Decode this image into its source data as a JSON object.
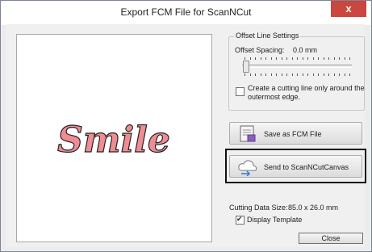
{
  "window": {
    "title": "Export FCM File for ScanNCut",
    "close_glyph": "x"
  },
  "preview": {
    "word": "Smile",
    "fill_color": "#f08c94",
    "stroke_color": "#222222"
  },
  "offset_group": {
    "legend": "Offset Line Settings",
    "spacing_label": "Offset Spacing:",
    "spacing_value": "0.0 mm",
    "slider_value_fraction": 0,
    "cutting_line_label": "Create a cutting line only around the outermost edge.",
    "cutting_line_label_line1": "Create a cutting line only around the",
    "cutting_line_label_line2": "outermost edge.",
    "cutting_line_checked": false
  },
  "buttons": {
    "save_fcm": "Save as FCM File",
    "send_canvas": "Send to ScanNCutCanvas",
    "close": "Close"
  },
  "info": {
    "cutting_size_label": "Cutting Data Size:",
    "cutting_size_value": "85.0 x 26.0 mm",
    "display_template_label": "Display Template",
    "display_template_checked": true
  },
  "icons": {
    "save": "fcm-file-icon",
    "send": "cloud-upload-icon"
  }
}
